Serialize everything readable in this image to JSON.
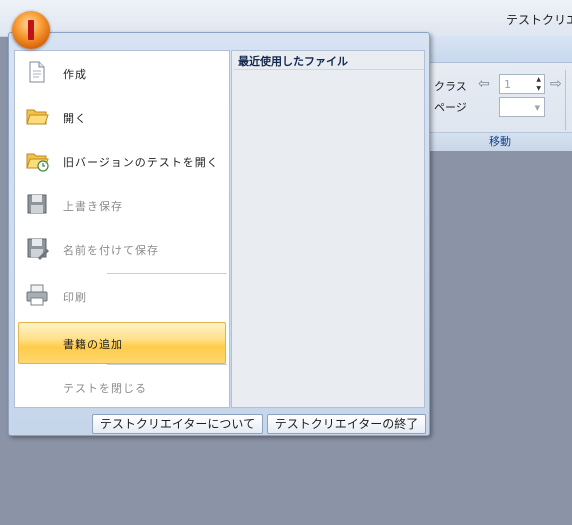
{
  "window": {
    "title": "テストクリエ"
  },
  "ribbon": {
    "class_label": "クラス",
    "page_label": "ページ",
    "class_value": "1",
    "group_label": "移動"
  },
  "menu": {
    "items": [
      {
        "label": "作成",
        "icon": "document-icon",
        "enabled": true
      },
      {
        "label": "開く",
        "icon": "folder-icon",
        "enabled": true
      },
      {
        "label": "旧バージョンのテストを開く",
        "icon": "folder-legacy-icon",
        "enabled": true
      },
      {
        "label": "上書き保存",
        "icon": "save-icon",
        "enabled": false
      },
      {
        "label": "名前を付けて保存",
        "icon": "save-as-icon",
        "enabled": false
      },
      {
        "label": "印刷",
        "icon": "printer-icon",
        "enabled": false
      },
      {
        "label": "書籍の追加",
        "icon": "",
        "enabled": true,
        "highlighted": true
      },
      {
        "label": "テストを閉じる",
        "icon": "",
        "enabled": false
      }
    ],
    "recent_title": "最近使用したファイル",
    "about_button": "テストクリエイターについて",
    "exit_button": "テストクリエイターの終了"
  },
  "colors": {
    "highlight": "#ffd770",
    "workspace": "#8b93a6",
    "accent_text": "#15428b"
  }
}
